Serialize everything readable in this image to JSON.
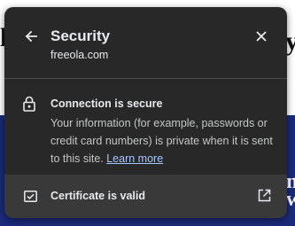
{
  "background": {
    "glyph_left": "l",
    "glyph_right_top": "y",
    "glyph_right_mid": "n",
    "glyph_right_bottom": "w"
  },
  "popup": {
    "title": "Security",
    "domain": "freeola.com",
    "connection": {
      "title": "Connection is secure",
      "description": "Your information (for example, passwords or credit card numbers) is private when it is sent to this site.",
      "learn_more": "Learn more"
    },
    "certificate": {
      "label": "Certificate is valid"
    }
  },
  "icons": {
    "back": "arrow-left",
    "close": "x",
    "lock": "lock",
    "certificate": "checked-box",
    "external": "open-in-new"
  },
  "colors": {
    "popup_bg": "#282828",
    "row_bg": "#393939",
    "text": "#e8eaed",
    "link": "#a8c7fa",
    "page_blue": "#1b2a7a"
  }
}
